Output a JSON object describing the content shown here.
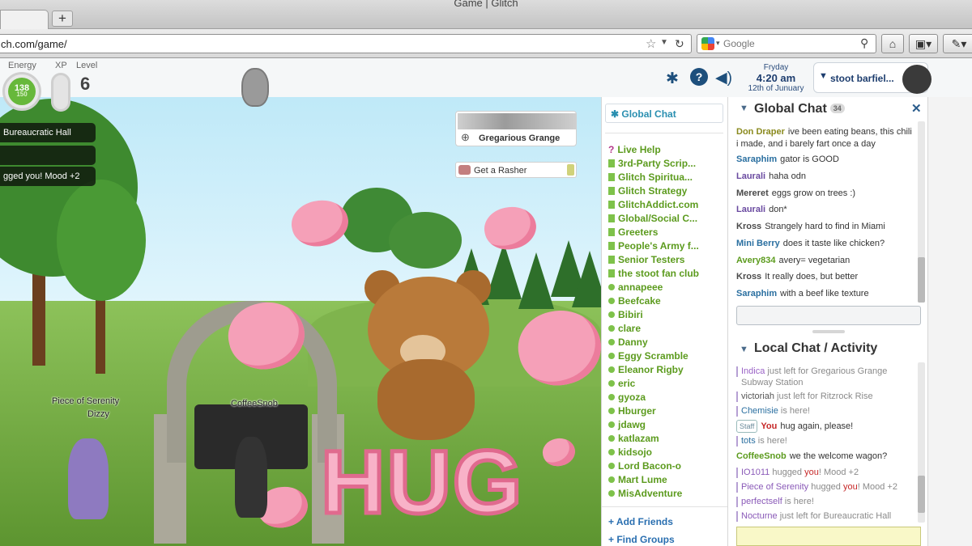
{
  "browser": {
    "window_title": "Game | Glitch",
    "new_tab_label": "+",
    "url": "ch.com/game/",
    "search_placeholder": "Google",
    "star_icon": "star-icon",
    "reload_icon": "reload-icon"
  },
  "hud": {
    "energy_label": "Energy",
    "xp_label": "XP",
    "level_label": "Level",
    "energy_value": "138",
    "energy_max": "150",
    "level_value": "6",
    "game_day": "Fryday",
    "game_time": "4:20 am",
    "game_date": "12th of Junuary",
    "username": "stoot barfiel..."
  },
  "game": {
    "location_name": "Gregarious Grange",
    "quest_label": "Get a Rasher",
    "overlay_1": "Bureaucratic Hall",
    "overlay_3": "gged you! Mood +2",
    "player_tag_1": "Piece of Serenity",
    "player_tag_2": "Dizzy",
    "player_tag_3": "CoffeeSnob",
    "hug_banner": "HUG"
  },
  "channels": {
    "active": "Global Chat",
    "items": [
      "Live Help",
      "3rd-Party Scrip...",
      "Glitch Spiritua...",
      "Glitch Strategy",
      "GlitchAddict.com",
      "Global/Social C...",
      "Greeters",
      "People's Army f...",
      "Senior Testers",
      "the stoot fan club",
      "annapeee",
      "Beefcake",
      "Bibiri",
      "clare",
      "Danny",
      "Eggy Scramble",
      "Eleanor Rigby",
      "eric",
      "gyoza",
      "Hburger",
      "jdawg",
      "katlazam",
      "kidsojo",
      "Lord Bacon-o",
      "Mart Lume",
      "MisAdventure"
    ],
    "add_friends": "+ Add Friends",
    "find_groups": "+ Find Groups"
  },
  "global_chat": {
    "title": "Global Chat",
    "count": "34",
    "messages": [
      {
        "who": "Don Draper",
        "text": "ive been eating beans, this chili i made, and i barely fart once a day",
        "color": "#8a8a1e"
      },
      {
        "who": "Saraphim",
        "text": "gator is GOOD",
        "color": "#2a6fa0"
      },
      {
        "who": "Laurali",
        "text": "haha odn",
        "color": "#6a4aa0"
      },
      {
        "who": "Mereret",
        "text": "eggs grow on trees :)",
        "color": "#4a4a4a"
      },
      {
        "who": "Laurali",
        "text": "don*",
        "color": "#6a4aa0"
      },
      {
        "who": "Kross",
        "text": "Strangely hard to find in Miami",
        "color": "#4a4a4a"
      },
      {
        "who": "Mini Berry",
        "text": "does it taste like chicken?",
        "color": "#2a6fa0"
      },
      {
        "who": "Avery834",
        "text": "avery= vegetarian",
        "color": "#5c9b1e"
      },
      {
        "who": "Kross",
        "text": "It really does, but better",
        "color": "#4a4a4a"
      },
      {
        "who": "Saraphim",
        "text": "with a beef like texture",
        "color": "#2a6fa0"
      }
    ]
  },
  "local_chat": {
    "title": "Local Chat / Activity",
    "line1_name": "Indica",
    "line1_text": " just left for Gregarious Grange Subway Station",
    "line2_name": "victoriah",
    "line2_text": " just left for Ritzrock Rise",
    "line3_name": "Chemisie",
    "line3_text": " is here!",
    "line4_badge": "Staff",
    "line4_name": "You",
    "line4_text": "hug again, please!",
    "line5_name": "tots",
    "line5_text": " is here!",
    "line6_name": "CoffeeSnob",
    "line6_text": "we the welcome wagon?",
    "line7_name": "IO1011",
    "line7_text_a": " hugged ",
    "line7_you": "you",
    "line7_text_b": "! Mood +2",
    "line8_name": "Piece of Serenity",
    "line8_text_a": " hugged ",
    "line8_you": "you",
    "line8_text_b": "! Mood +2",
    "line9_name": "perfectself",
    "line9_text": " is here!",
    "line10_name": "Nocturne",
    "line10_text": " just left for Bureaucratic Hall"
  }
}
